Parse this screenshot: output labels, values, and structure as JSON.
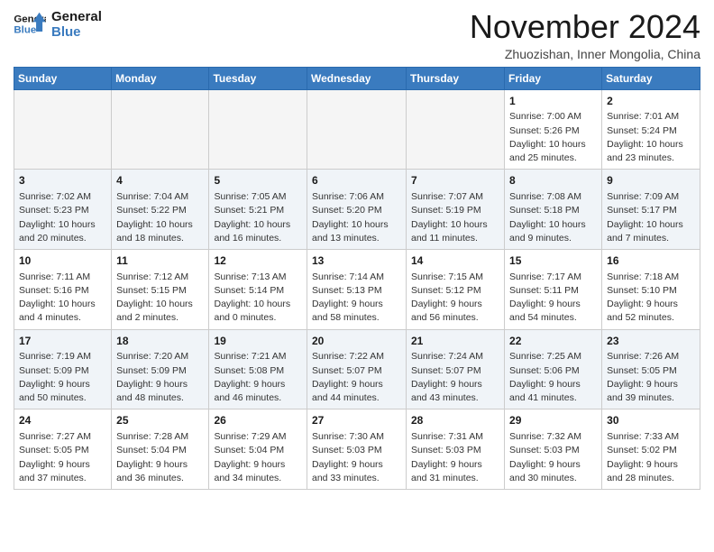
{
  "logo": {
    "line1": "General",
    "line2": "Blue"
  },
  "title": "November 2024",
  "subtitle": "Zhuozishan, Inner Mongolia, China",
  "weekdays": [
    "Sunday",
    "Monday",
    "Tuesday",
    "Wednesday",
    "Thursday",
    "Friday",
    "Saturday"
  ],
  "weeks": [
    [
      {
        "day": "",
        "info": ""
      },
      {
        "day": "",
        "info": ""
      },
      {
        "day": "",
        "info": ""
      },
      {
        "day": "",
        "info": ""
      },
      {
        "day": "",
        "info": ""
      },
      {
        "day": "1",
        "info": "Sunrise: 7:00 AM\nSunset: 5:26 PM\nDaylight: 10 hours\nand 25 minutes."
      },
      {
        "day": "2",
        "info": "Sunrise: 7:01 AM\nSunset: 5:24 PM\nDaylight: 10 hours\nand 23 minutes."
      }
    ],
    [
      {
        "day": "3",
        "info": "Sunrise: 7:02 AM\nSunset: 5:23 PM\nDaylight: 10 hours\nand 20 minutes."
      },
      {
        "day": "4",
        "info": "Sunrise: 7:04 AM\nSunset: 5:22 PM\nDaylight: 10 hours\nand 18 minutes."
      },
      {
        "day": "5",
        "info": "Sunrise: 7:05 AM\nSunset: 5:21 PM\nDaylight: 10 hours\nand 16 minutes."
      },
      {
        "day": "6",
        "info": "Sunrise: 7:06 AM\nSunset: 5:20 PM\nDaylight: 10 hours\nand 13 minutes."
      },
      {
        "day": "7",
        "info": "Sunrise: 7:07 AM\nSunset: 5:19 PM\nDaylight: 10 hours\nand 11 minutes."
      },
      {
        "day": "8",
        "info": "Sunrise: 7:08 AM\nSunset: 5:18 PM\nDaylight: 10 hours\nand 9 minutes."
      },
      {
        "day": "9",
        "info": "Sunrise: 7:09 AM\nSunset: 5:17 PM\nDaylight: 10 hours\nand 7 minutes."
      }
    ],
    [
      {
        "day": "10",
        "info": "Sunrise: 7:11 AM\nSunset: 5:16 PM\nDaylight: 10 hours\nand 4 minutes."
      },
      {
        "day": "11",
        "info": "Sunrise: 7:12 AM\nSunset: 5:15 PM\nDaylight: 10 hours\nand 2 minutes."
      },
      {
        "day": "12",
        "info": "Sunrise: 7:13 AM\nSunset: 5:14 PM\nDaylight: 10 hours\nand 0 minutes."
      },
      {
        "day": "13",
        "info": "Sunrise: 7:14 AM\nSunset: 5:13 PM\nDaylight: 9 hours\nand 58 minutes."
      },
      {
        "day": "14",
        "info": "Sunrise: 7:15 AM\nSunset: 5:12 PM\nDaylight: 9 hours\nand 56 minutes."
      },
      {
        "day": "15",
        "info": "Sunrise: 7:17 AM\nSunset: 5:11 PM\nDaylight: 9 hours\nand 54 minutes."
      },
      {
        "day": "16",
        "info": "Sunrise: 7:18 AM\nSunset: 5:10 PM\nDaylight: 9 hours\nand 52 minutes."
      }
    ],
    [
      {
        "day": "17",
        "info": "Sunrise: 7:19 AM\nSunset: 5:09 PM\nDaylight: 9 hours\nand 50 minutes."
      },
      {
        "day": "18",
        "info": "Sunrise: 7:20 AM\nSunset: 5:09 PM\nDaylight: 9 hours\nand 48 minutes."
      },
      {
        "day": "19",
        "info": "Sunrise: 7:21 AM\nSunset: 5:08 PM\nDaylight: 9 hours\nand 46 minutes."
      },
      {
        "day": "20",
        "info": "Sunrise: 7:22 AM\nSunset: 5:07 PM\nDaylight: 9 hours\nand 44 minutes."
      },
      {
        "day": "21",
        "info": "Sunrise: 7:24 AM\nSunset: 5:07 PM\nDaylight: 9 hours\nand 43 minutes."
      },
      {
        "day": "22",
        "info": "Sunrise: 7:25 AM\nSunset: 5:06 PM\nDaylight: 9 hours\nand 41 minutes."
      },
      {
        "day": "23",
        "info": "Sunrise: 7:26 AM\nSunset: 5:05 PM\nDaylight: 9 hours\nand 39 minutes."
      }
    ],
    [
      {
        "day": "24",
        "info": "Sunrise: 7:27 AM\nSunset: 5:05 PM\nDaylight: 9 hours\nand 37 minutes."
      },
      {
        "day": "25",
        "info": "Sunrise: 7:28 AM\nSunset: 5:04 PM\nDaylight: 9 hours\nand 36 minutes."
      },
      {
        "day": "26",
        "info": "Sunrise: 7:29 AM\nSunset: 5:04 PM\nDaylight: 9 hours\nand 34 minutes."
      },
      {
        "day": "27",
        "info": "Sunrise: 7:30 AM\nSunset: 5:03 PM\nDaylight: 9 hours\nand 33 minutes."
      },
      {
        "day": "28",
        "info": "Sunrise: 7:31 AM\nSunset: 5:03 PM\nDaylight: 9 hours\nand 31 minutes."
      },
      {
        "day": "29",
        "info": "Sunrise: 7:32 AM\nSunset: 5:03 PM\nDaylight: 9 hours\nand 30 minutes."
      },
      {
        "day": "30",
        "info": "Sunrise: 7:33 AM\nSunset: 5:02 PM\nDaylight: 9 hours\nand 28 minutes."
      }
    ]
  ],
  "colors": {
    "header_bg": "#3a7bbf",
    "header_text": "#ffffff",
    "row_even": "#f0f4f8",
    "row_odd": "#ffffff",
    "empty_bg": "#f5f5f5"
  }
}
